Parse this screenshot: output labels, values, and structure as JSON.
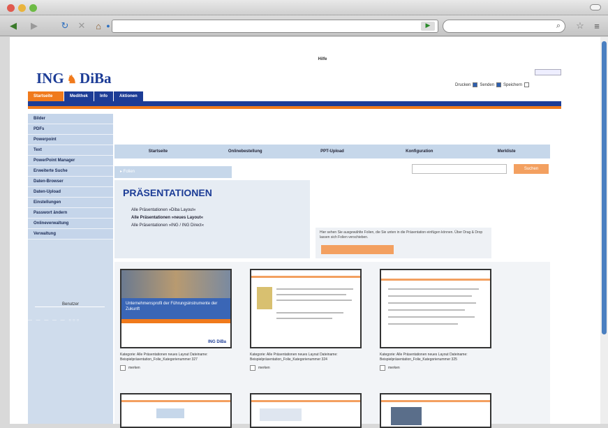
{
  "browser": {
    "icons": [
      "back-icon",
      "forward-icon",
      "reload-icon",
      "stop-icon",
      "home-icon",
      "site-icon"
    ],
    "url_go": "▶"
  },
  "site": {
    "top_tab": "Hilfe",
    "logo_left": "ING",
    "logo_right": "DiBa",
    "options": {
      "label": "Drucken",
      "opt1": "Senden",
      "opt2": "Speichern"
    },
    "main_nav": [
      "Startseite",
      "Medithek",
      "Info",
      "Aktionen"
    ],
    "sidebar": [
      "Bilder",
      "PDFs",
      "Powerpoint",
      "Text",
      "PowerPoint Manager",
      "Erweiterte Suche",
      "Daten-Browser",
      "Daten-Upload",
      "Einstellungen",
      "Passwort ändern",
      "Onlineverwaltung",
      "Verwaltung"
    ],
    "sidebar_button": "Benutzer",
    "sidebar_dots": "— — — — — ○○○",
    "sub_nav": [
      "Startseite",
      "Onlinebestellung",
      "PPT-Upload",
      "Konfiguration",
      "Merkliste"
    ],
    "crumb": "▸ Folien",
    "crumb_button": "Suchen",
    "presentations": {
      "title": "PRÄSENTATIONEN",
      "links": [
        "Alle Präsentationen »Diba Layout«",
        "Alle Präsentationen »neues Layout«",
        "Alle Präsentationen »ING / ING Direct«"
      ]
    },
    "info_text": "Hier sehen Sie ausgewählte Folien, die Sie unten in die Präsentation einfügen können. Über Drag & Drop lassen sich Folien verschieben.",
    "cards": [
      {
        "caption": "Kategorie: Alle Präsentationen neues Layout Dateiname: Beispielpräsentation_Folie_Kategorienummer 327",
        "check": "merken"
      },
      {
        "caption": "Kategorie: Alle Präsentationen neues Layout Dateiname: Beispielpräsentation_Folie_Kategorienummer 324",
        "check": "merken"
      },
      {
        "caption": "Kategorie: Alle Präsentationen neues Layout Dateiname: Beispielpräsentation_Folie_Kategorienummer 325",
        "check": "merken"
      }
    ],
    "card1_headline": "Unternehmensprofil der Führungsinstrumente der Zukunft",
    "card1_logo": "ING DiBa"
  }
}
